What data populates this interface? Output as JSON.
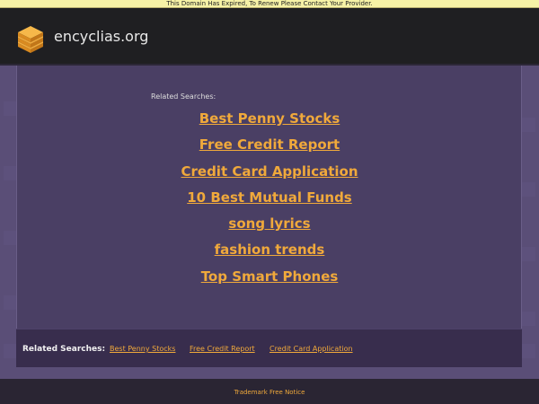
{
  "notice": {
    "text": "This Domain Has Expired, To Renew Please Contact Your Provider."
  },
  "header": {
    "site_name": "encyclias.org",
    "logo_icon": "stacked-cube-logo-icon",
    "logo_color": "#f0a93b"
  },
  "main": {
    "related_label": "Related Searches:",
    "links": [
      "Best Penny Stocks",
      "Free Credit Report",
      "Credit Card Application",
      "10 Best Mutual Funds",
      "song lyrics",
      "fashion trends",
      "Top Smart Phones"
    ]
  },
  "bottom": {
    "label": "Related Searches:",
    "links": [
      "Best Penny Stocks",
      "Free Credit Report",
      "Credit Card Application"
    ]
  },
  "footer": {
    "link": "Trademark Free Notice"
  },
  "colors": {
    "accent": "#f0a93b",
    "background": "#564a72",
    "header": "#1f1f22",
    "notice": "#f6f2a6"
  }
}
